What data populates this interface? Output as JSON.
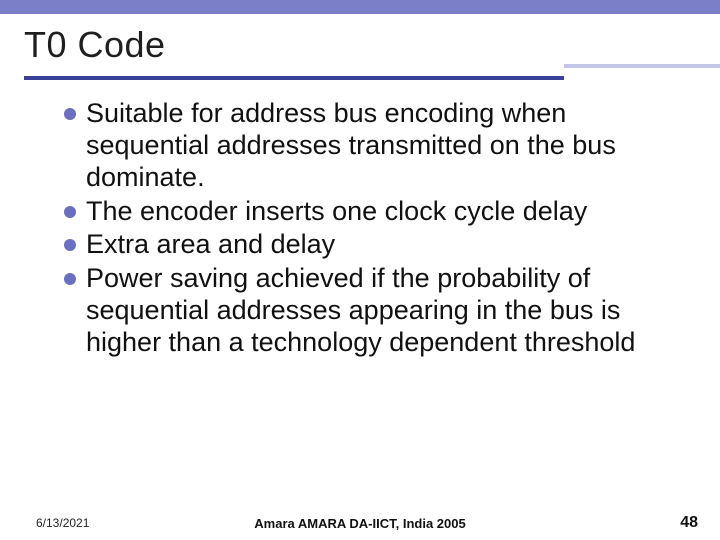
{
  "title": "T0 Code",
  "bullets": [
    "Suitable for address bus encoding when sequential addresses transmitted on the bus dominate.",
    "The encoder inserts one clock cycle delay",
    "Extra area and delay",
    "Power saving achieved if the probability of sequential addresses appearing in the bus is higher than a technology dependent threshold"
  ],
  "footer": {
    "date": "6/13/2021",
    "center": "Amara AMARA DA-IICT, India 2005",
    "page": "48"
  }
}
